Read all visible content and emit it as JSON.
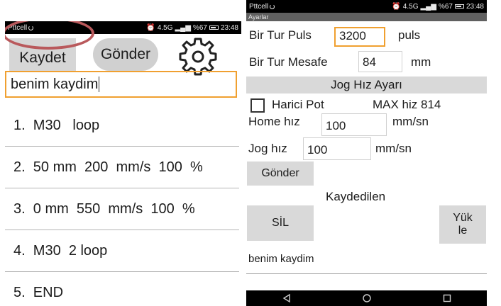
{
  "left_phone": {
    "status": {
      "carrier": "Pttcell",
      "time": "23:48",
      "battery": "%67",
      "network": "4.5G"
    },
    "buttons": {
      "save": "Kaydet",
      "send": "Gönder"
    },
    "name_input": {
      "value": "benim kaydim"
    },
    "program_list": [
      "1.  M30   loop",
      "2.  50 mm  200  mm/s  100  %",
      "3.  0 mm  550  mm/s  100  %",
      "4.  M30  2 loop",
      "5.  END"
    ],
    "highlight_color": "#b9595c",
    "focus_color": "#f0a030"
  },
  "right_phone": {
    "status": {
      "carrier": "Pttcell",
      "time": "23:48",
      "battery": "%67",
      "network": "4.5G"
    },
    "app_title": "Ayarlar",
    "pulses_per_rev": {
      "label": "Bir Tur Puls",
      "value": "3200",
      "unit": "puls"
    },
    "distance_per_rev": {
      "label": "Bir Tur Mesafe",
      "value": "84",
      "unit": "mm"
    },
    "jog_section_title": "Jog Hız Ayarı",
    "external_pot": {
      "label": "Harici Pot",
      "checked": false
    },
    "max_speed": "MAX hiz 814",
    "home_speed": {
      "label": "Home hız",
      "value": "100",
      "unit": "mm/sn"
    },
    "jog_speed": {
      "label": "Jog hız",
      "value": "100",
      "unit": "mm/sn"
    },
    "send_button": "Gönder",
    "saved_label": "Kaydedilen",
    "delete_button": "SİL",
    "load_button_line1": "Yük",
    "load_button_line2": "le",
    "saved_item": "benim kaydim"
  }
}
